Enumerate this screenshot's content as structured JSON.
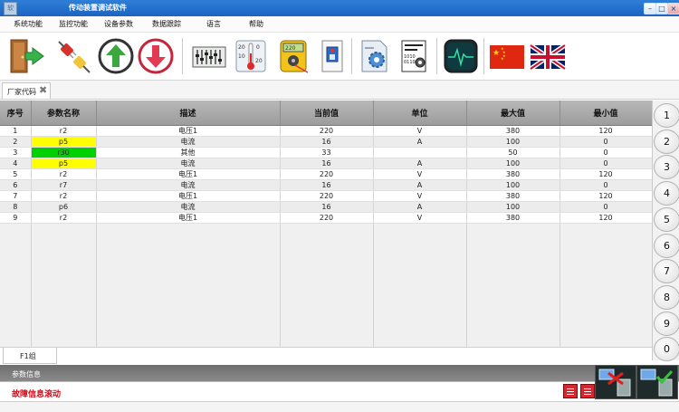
{
  "window": {
    "title": "传动装置调试软件",
    "app_icon_text": "软"
  },
  "menu": [
    "系统功能",
    "监控功能",
    "设备参数",
    "数据跟踪",
    "语言",
    "帮助"
  ],
  "toolbar_icons": [
    "exit-door-icon",
    "disconnect-plug-icon",
    "upload-arrow-icon",
    "download-arrow-icon",
    "parameter-sliders-icon",
    "temperature-gauge-icon",
    "multimeter-icon",
    "device-panel-icon",
    "settings-document-icon",
    "binary-code-icon",
    "oscilloscope-icon",
    "china-flag-icon",
    "uk-flag-icon"
  ],
  "tab": {
    "label": "厂家代码"
  },
  "grid": {
    "columns": [
      "序号",
      "参数名称",
      "描述",
      "当前值",
      "单位",
      "最大值",
      "最小值"
    ],
    "rows": [
      {
        "no": "1",
        "name": "r2",
        "desc": "电压1",
        "value": "220",
        "unit": "V",
        "max": "380",
        "min": "120",
        "highlight": ""
      },
      {
        "no": "2",
        "name": "p5",
        "desc": "电流",
        "value": "16",
        "unit": "A",
        "max": "100",
        "min": "0",
        "highlight": "#ffff00"
      },
      {
        "no": "3",
        "name": "r30",
        "desc": "其他",
        "value": "33",
        "unit": "",
        "max": "50",
        "min": "0",
        "highlight": "#00d000"
      },
      {
        "no": "4",
        "name": "p5",
        "desc": "电流",
        "value": "16",
        "unit": "A",
        "max": "100",
        "min": "0",
        "highlight": "#ffff00"
      },
      {
        "no": "5",
        "name": "r2",
        "desc": "电压1",
        "value": "220",
        "unit": "V",
        "max": "380",
        "min": "120",
        "highlight": ""
      },
      {
        "no": "6",
        "name": "r7",
        "desc": "电流",
        "value": "16",
        "unit": "A",
        "max": "100",
        "min": "0",
        "highlight": ""
      },
      {
        "no": "7",
        "name": "r2",
        "desc": "电压1",
        "value": "220",
        "unit": "V",
        "max": "380",
        "min": "120",
        "highlight": ""
      },
      {
        "no": "8",
        "name": "p6",
        "desc": "电流",
        "value": "16",
        "unit": "A",
        "max": "100",
        "min": "0",
        "highlight": ""
      },
      {
        "no": "9",
        "name": "r2",
        "desc": "电压1",
        "value": "220",
        "unit": "V",
        "max": "380",
        "min": "120",
        "highlight": ""
      }
    ]
  },
  "number_buttons": [
    "1",
    "2",
    "3",
    "4",
    "5",
    "6",
    "7",
    "8",
    "9",
    "0"
  ],
  "bottom_tab": {
    "label": "F1组"
  },
  "status": {
    "param_info": "参数信息",
    "fault_scroll": "故障信息滚动",
    "fault_color": "#c8101c"
  }
}
